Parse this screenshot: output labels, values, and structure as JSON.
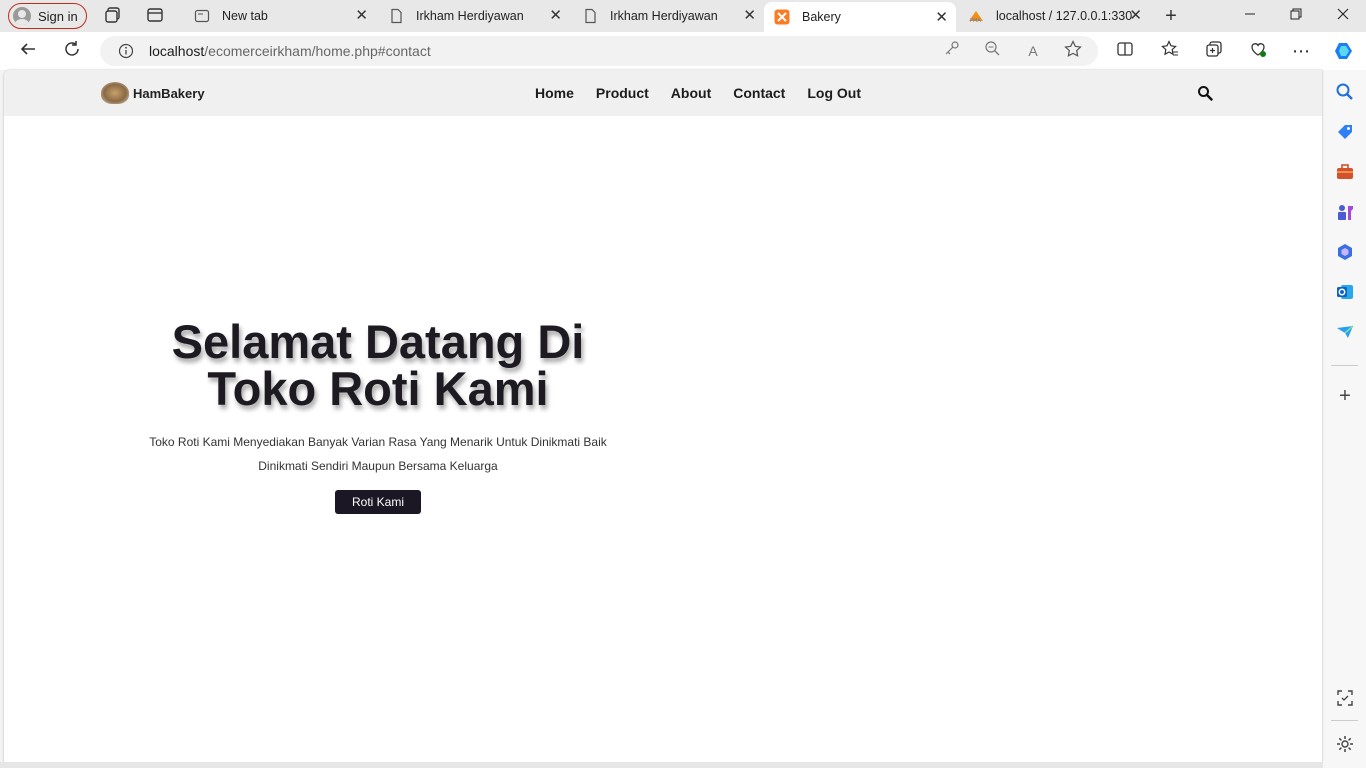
{
  "browser": {
    "signin_label": "Sign in",
    "tabs": [
      {
        "label": "New tab"
      },
      {
        "label": "Irkham Herdiyawan"
      },
      {
        "label": "Irkham Herdiyawan"
      },
      {
        "label": "Bakery"
      },
      {
        "label": "localhost / 127.0.0.1:330"
      }
    ],
    "url_host": "localhost",
    "url_path": "/ecomerceirkham/home.php#contact"
  },
  "site": {
    "brand": "HamBakery",
    "nav": [
      {
        "label": "Home"
      },
      {
        "label": "Product"
      },
      {
        "label": "About"
      },
      {
        "label": "Contact"
      },
      {
        "label": "Log Out"
      }
    ],
    "hero": {
      "title_line1": "Selamat Datang Di",
      "title_line2": "Toko Roti Kami",
      "text_line1": "Toko Roti Kami Menyediakan Banyak Varian Rasa Yang Menarik Untuk Dinikmati Baik",
      "text_line2": "Dinikmati Sendiri Maupun Bersama Keluarga",
      "button": "Roti Kami"
    }
  },
  "colors": {
    "accent_dark": "#1b1724",
    "signin_border": "#c42b1c"
  }
}
